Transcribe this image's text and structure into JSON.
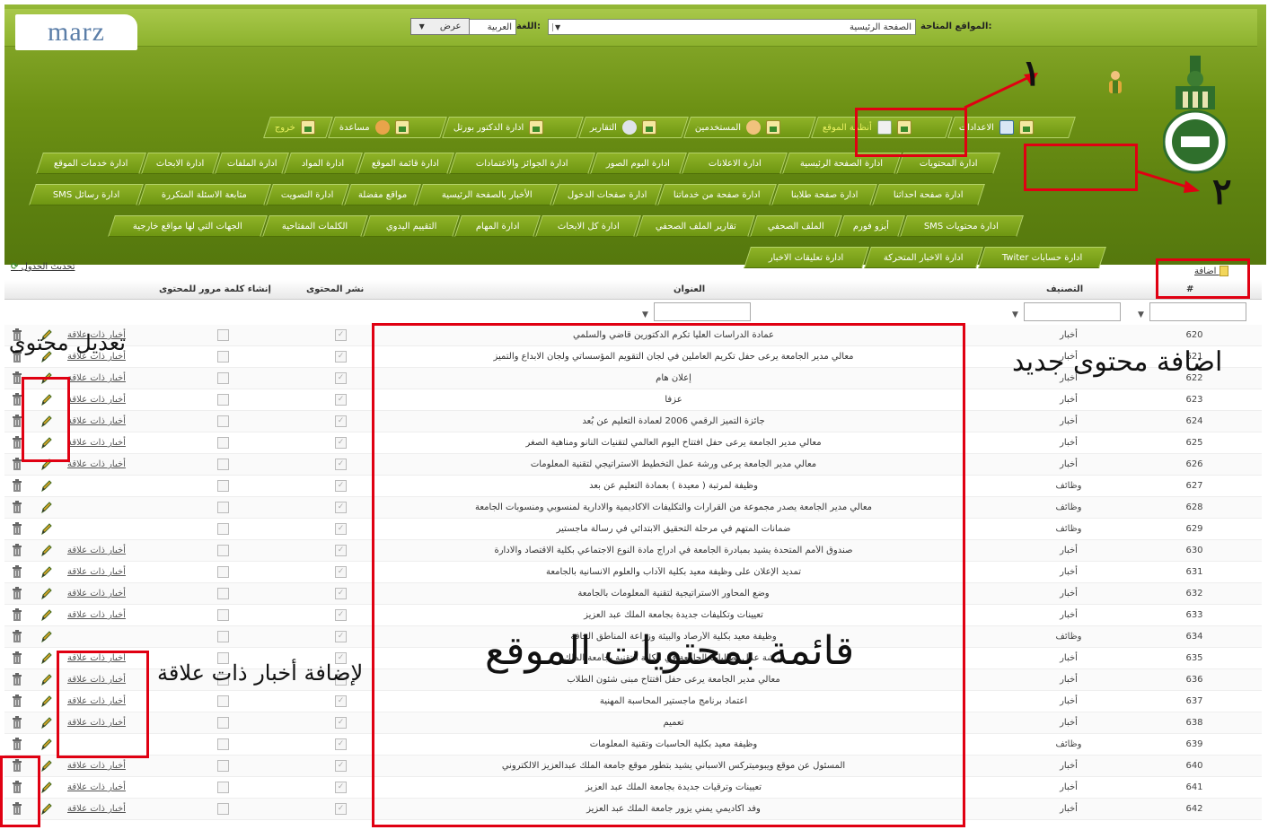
{
  "brand": {
    "logo_text": "marz"
  },
  "topbar": {
    "sites_label": "المواقع المتاحة:",
    "site_value": "الصفحة الرئيسية",
    "lang_label": "اللغة:",
    "lang_value": "العربية",
    "view_button": "عرض"
  },
  "main_menu": [
    {
      "label": "الاعدادات"
    },
    {
      "label": "أنظمة الموقع"
    },
    {
      "label": "المستخدمين"
    },
    {
      "label": "التقارير"
    },
    {
      "label": "ادارة الدكتور بورتل"
    },
    {
      "label": "مساعدة"
    },
    {
      "label": "خروج"
    }
  ],
  "submenu_rows": [
    [
      "ادارة المحتويات",
      "ادارة الصفحة الرئيسية",
      "ادارة الاعلانات",
      "ادارة البوم الصور",
      "ادارة الجوائز والاعتمادات",
      "ادارة قائمة الموقع",
      "ادارة المواد",
      "ادارة الملفات",
      "ادارة الابحاث",
      "ادارة خدمات الموقع"
    ],
    [
      "ادارة صفحة احداثنا",
      "ادارة صفحة طلابنا",
      "ادارة صفحة من خدماتنا",
      "ادارة صفحات الدخول",
      "الأخبار بالصفحة الرئيسية",
      "مواقع مفضلة",
      "ادارة التصويت",
      "متابعة الاسئلة المتكررة",
      "SMS ادارة رسائل"
    ],
    [
      "SMS ادارة محتويات",
      "أيزو فورم",
      "الملف الصحفي",
      "تقارير الملف الصحفي",
      "ادارة كل الابحاث",
      "ادارة المهام",
      "التقييم اليدوي",
      "الكلمات المفتاحية",
      "الجهات التي لها مواقع خارجية"
    ],
    [
      "Twiter ادارة حسابات",
      "ادارة الاخبار المتحركة",
      "ادارة تعليقات الاخبار"
    ]
  ],
  "table": {
    "refresh_label": "تحديث الجدول",
    "add_label": "اضافة",
    "columns": {
      "num": "#",
      "category": "التصنيف",
      "title": "العنوان",
      "publish": "نشر المحتوى",
      "password": "إنشاء كلمة مرور للمحتوى"
    },
    "related_label": "أخبار ذات علاقة",
    "rows": [
      {
        "num": "620",
        "cat": "أخبار",
        "title": "عمادة الدراسات العليا تكرم الدكتورين قاضي والسلمي",
        "rel": true
      },
      {
        "num": "621",
        "cat": "أخبار",
        "title": "معالي مدير الجامعة يرعى حفل تكريم العاملين في لجان التقويم المؤسساتي ولجان الابداع والتميز",
        "rel": true
      },
      {
        "num": "622",
        "cat": "أخبار",
        "title": "إعلان هام",
        "rel": true
      },
      {
        "num": "623",
        "cat": "أخبار",
        "title": "عزفاً",
        "rel": true
      },
      {
        "num": "624",
        "cat": "أخبار",
        "title": "جائزة التميز الرقمي 2006 لعمادة التعليم عن بُعد",
        "rel": true
      },
      {
        "num": "625",
        "cat": "أخبار",
        "title": "معالي مدير الجامعة يرعى حفل افتتاح اليوم العالمي لتقنيات النانو ومناهية الصغر",
        "rel": true
      },
      {
        "num": "626",
        "cat": "أخبار",
        "title": "معالي مدير الجامعة يرعى ورشة عمل التخطيط الاستراتيجي لتقنية المعلومات",
        "rel": true
      },
      {
        "num": "627",
        "cat": "وظائف",
        "title": "وظيفة لمرتبة ( معيدة ) بعمادة التعليم عن بعد",
        "rel": false
      },
      {
        "num": "628",
        "cat": "وظائف",
        "title": "معالي مدير الجامعة يصدر مجموعة من القرارات والتكليفات الاكاديمية والادارية لمنسوبي ومنسوبات الجامعة",
        "rel": false
      },
      {
        "num": "629",
        "cat": "وظائف",
        "title": "ضمانات المتهم في مرحلة التحقيق الابتدائي في رسالة ماجستير",
        "rel": false
      },
      {
        "num": "630",
        "cat": "أخبار",
        "title": "صندوق الأمم المتحدة يشيد بمبادرة الجامعة في أدراج مادة النوع الاجتماعي بكلية الاقتصاد والادارة",
        "rel": true
      },
      {
        "num": "631",
        "cat": "أخبار",
        "title": "تمديد الإعلان على وظيفة معيد بكلية الآداب والعلوم الانسانية بالجامعة",
        "rel": true
      },
      {
        "num": "632",
        "cat": "أخبار",
        "title": "وضع المحاور الاستراتيجية لتقنية المعلومات بالجامعة",
        "rel": true
      },
      {
        "num": "633",
        "cat": "أخبار",
        "title": "تعيينات وتكليفات جديدة بجامعة الملك عبد العزيز",
        "rel": true
      },
      {
        "num": "634",
        "cat": "وظائف",
        "title": "وظيفة معيد بكلية الأرصاد والبيئة وزراعة المناطق الجافة",
        "rel": false
      },
      {
        "num": "635",
        "cat": "أخبار",
        "title": "ورشة عمل لطالبات الجامعة في الكلية التقنية بجامعة الملك",
        "rel": true
      },
      {
        "num": "636",
        "cat": "أخبار",
        "title": "معالي مدير الجامعة يرعى حفل افتتاح مبنى شئون الطلاب",
        "rel": true
      },
      {
        "num": "637",
        "cat": "أخبار",
        "title": "اعتماد برنامج ماجستير المحاسبة المهنية",
        "rel": true
      },
      {
        "num": "638",
        "cat": "أخبار",
        "title": "تعميم",
        "rel": true
      },
      {
        "num": "639",
        "cat": "وظائف",
        "title": "وظيفة معيد بكلية الحاسبات وتقنية المعلومات",
        "rel": false
      },
      {
        "num": "640",
        "cat": "أخبار",
        "title": "المسئول عن موقع ويبوميتركس الاسباني يشيد بتطور موقع جامعة الملك عبدالعزيز الالكتروني",
        "rel": true
      },
      {
        "num": "641",
        "cat": "أخبار",
        "title": "تعيينات وترقيات جديدة بجامعة الملك عبد العزيز",
        "rel": true
      },
      {
        "num": "642",
        "cat": "أخبار",
        "title": "وفد أكاديمي يمني يزور جامعة الملك عبد العزيز",
        "rel": true
      }
    ]
  },
  "annotations": {
    "num1": "١",
    "num2": "٢",
    "add_new": "اضافة محتوى جديد",
    "edit": "تعديل محتوى",
    "list": "قائمة بمحتويات الموقع",
    "related": "لإضافة أخبار ذات علاقة"
  },
  "colors": {
    "header_green": "#6d9114",
    "annotation_red": "#e00012"
  }
}
